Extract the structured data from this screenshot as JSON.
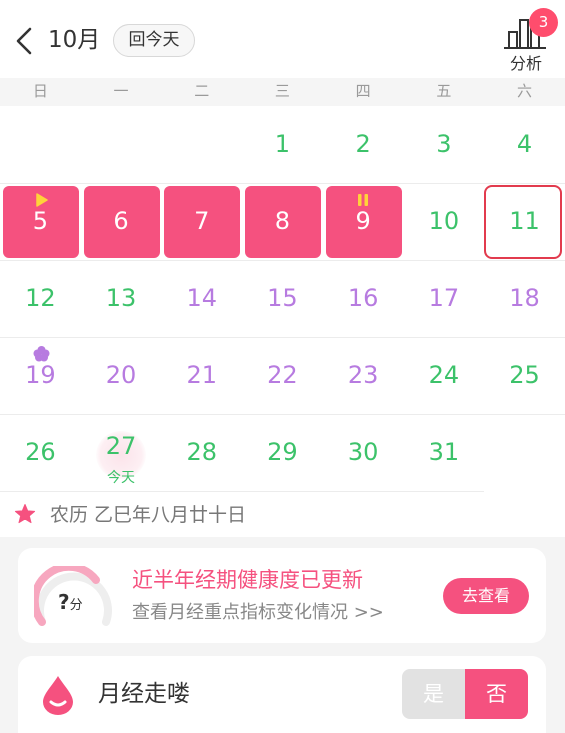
{
  "header": {
    "month": "10月",
    "today_label": "回今天",
    "analysis_label": "分析",
    "analysis_badge": "3"
  },
  "weekdays": [
    "日",
    "一",
    "二",
    "三",
    "四",
    "五",
    "六"
  ],
  "days": {
    "d1": "1",
    "d2": "2",
    "d3": "3",
    "d4": "4",
    "d5": "5",
    "d6": "6",
    "d7": "7",
    "d8": "8",
    "d9": "9",
    "d10": "10",
    "d11": "11",
    "d12": "12",
    "d13": "13",
    "d14": "14",
    "d15": "15",
    "d16": "16",
    "d17": "17",
    "d18": "18",
    "d19": "19",
    "d20": "20",
    "d21": "21",
    "d22": "22",
    "d23": "23",
    "d24": "24",
    "d25": "25",
    "d26": "26",
    "d27": "27",
    "d28": "28",
    "d29": "29",
    "d30": "30",
    "d31": "31"
  },
  "today_sub": "今天",
  "lunar": {
    "text": "农历 乙巳年八月廿十日"
  },
  "health_card": {
    "score": "?",
    "score_unit": "分",
    "title": "近半年经期健康度已更新",
    "subtitle": "查看月经重点指标变化情况 >>",
    "button": "去查看"
  },
  "period_card": {
    "label": "月经走喽",
    "yes": "是",
    "no": "否"
  },
  "colors": {
    "period": "#f5517f",
    "fertile": "#b77be0",
    "safe": "#3cc26a",
    "today_outline": "#e23b4e"
  }
}
